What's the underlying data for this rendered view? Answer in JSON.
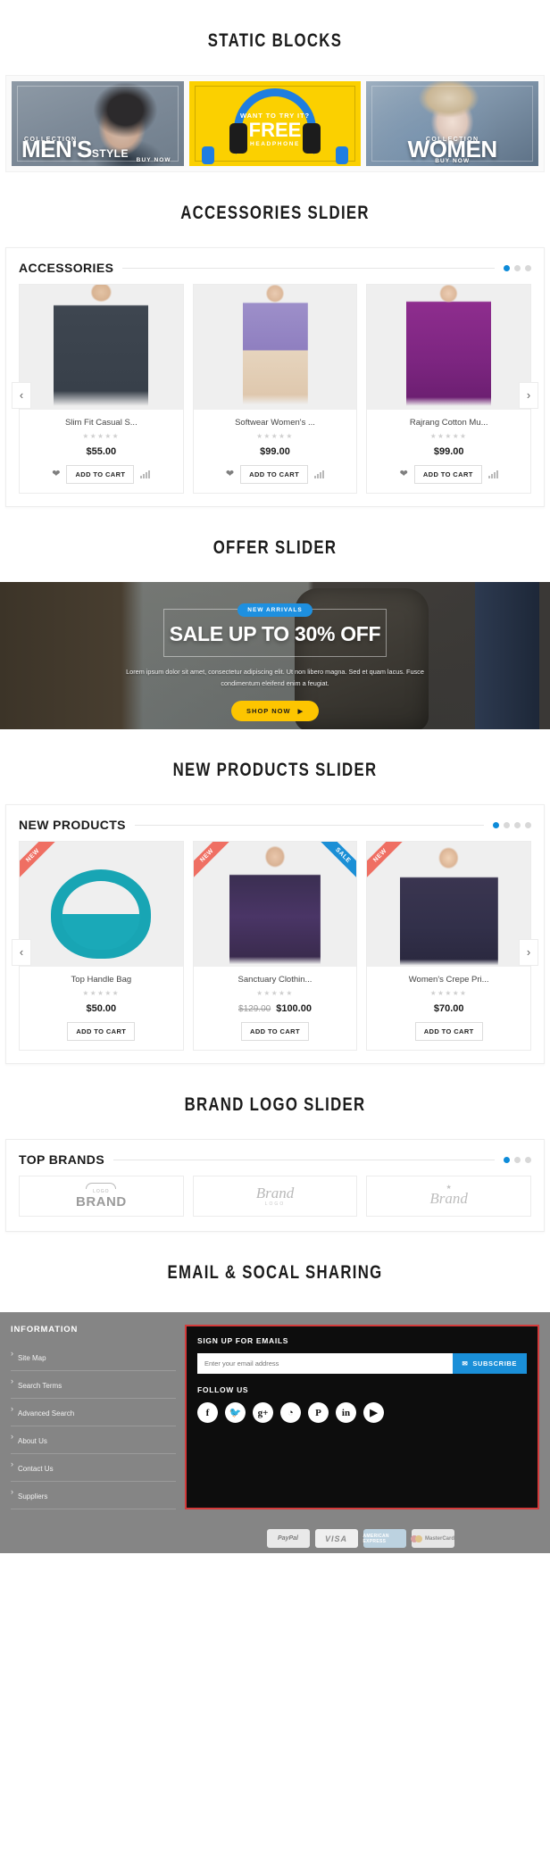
{
  "sections": {
    "static_blocks_title": "STATIC BLOCKS",
    "accessories_title": "ACCESSORIES SLDIER",
    "offer_title": "OFFER SLIDER",
    "new_products_title": "NEW PRODUCTS SLIDER",
    "brand_title": "BRAND LOGO SLIDER",
    "email_title": "EMAIL & SOCAL SHARING"
  },
  "static_blocks": [
    {
      "name": "mens-collection-block",
      "collection_label": "COLLECTION",
      "headline": "MEN'S",
      "headline_sub": "STYLE",
      "cta": "BUY NOW"
    },
    {
      "name": "free-headphone-block",
      "line1": "WANT TO TRY IT?",
      "line2": "FREE",
      "line3": "HEADPHONE"
    },
    {
      "name": "women-collection-block",
      "collection_label": "COLLECTION",
      "headline": "WOMEN",
      "cta": "BUY NOW"
    }
  ],
  "accessories_panel": {
    "heading": "ACCESSORIES",
    "dots": [
      true,
      false,
      false
    ],
    "prev_label": "‹",
    "next_label": "›",
    "add_to_cart_label": "ADD TO CART",
    "products": [
      {
        "name": "Slim Fit Casual S...",
        "rating": "★★★★★",
        "price": "$55.00",
        "old_price": "",
        "image": "ph-shirt"
      },
      {
        "name": "Softwear Women's ...",
        "rating": "★★★★★",
        "price": "$99.00",
        "old_price": "",
        "image": "ph-lace"
      },
      {
        "name": "Rajrang Cotton Mu...",
        "rating": "★★★★★",
        "price": "$99.00",
        "old_price": "",
        "image": "ph-purple"
      }
    ]
  },
  "offer_slider": {
    "badge": "NEW ARRIVALS",
    "headline": "SALE UP TO 30% OFF",
    "description": "Lorem ipsum dolor sit amet, consectetur adipiscing elit. Ut non libero magna. Sed et quam lacus. Fusce condimentum eleifend enim a feugiat.",
    "button": "SHOP NOW",
    "button_arrow": "▶",
    "dots": [
      true,
      false,
      false
    ]
  },
  "new_products_panel": {
    "heading": "NEW PRODUCTS",
    "dots": [
      true,
      false,
      false,
      false
    ],
    "prev_label": "‹",
    "next_label": "›",
    "add_to_cart_label": "ADD TO CART",
    "products": [
      {
        "name": "Top Handle Bag",
        "rating": "★★★★★",
        "price": "$50.00",
        "old_price": "",
        "badge_new": "NEW",
        "badge_sale": "",
        "image": "ph-bag"
      },
      {
        "name": "Sanctuary Clothin...",
        "rating": "★★★★★",
        "price": "$100.00",
        "old_price": "$129.00",
        "badge_new": "NEW",
        "badge_sale": "SALE",
        "image": "ph-jacket"
      },
      {
        "name": "Women's Crepe Pri...",
        "rating": "★★★★★",
        "price": "$70.00",
        "old_price": "",
        "badge_new": "NEW",
        "badge_sale": "",
        "image": "ph-crepe"
      }
    ]
  },
  "brands_panel": {
    "heading": "TOP BRANDS",
    "dots": [
      true,
      false,
      false
    ],
    "logos": [
      {
        "small": "LOGO",
        "main": "BRAND"
      },
      {
        "main": "Brand",
        "small": "LOGO"
      },
      {
        "main": "Brand",
        "small": "★"
      }
    ]
  },
  "footer": {
    "information_heading": "INFORMATION",
    "links": [
      "Site Map",
      "Search Terms",
      "Advanced Search",
      "About Us",
      "Contact Us",
      "Suppliers"
    ],
    "signup_heading": "SIGN UP FOR EMAILS",
    "email_placeholder": "Enter your email address",
    "subscribe_label": "SUBSCRIBE",
    "subscribe_icon": "✉",
    "follow_heading": "FOLLOW US",
    "socials": [
      {
        "name": "facebook",
        "glyph": "f"
      },
      {
        "name": "twitter",
        "glyph": "🐦"
      },
      {
        "name": "google-plus",
        "glyph": "g+"
      },
      {
        "name": "rss",
        "glyph": "◔"
      },
      {
        "name": "pinterest",
        "glyph": "P"
      },
      {
        "name": "linkedin",
        "glyph": "in"
      },
      {
        "name": "youtube",
        "glyph": "▶"
      }
    ],
    "payments": [
      {
        "name": "paypal",
        "label": "PayPal"
      },
      {
        "name": "visa",
        "label": "VISA"
      },
      {
        "name": "amex",
        "label": "AMERICAN EXPRESS"
      },
      {
        "name": "mastercard",
        "label": "MasterCard"
      }
    ]
  },
  "colors": {
    "accent_blue": "#0d8bd9",
    "yellow": "#fbd000",
    "ribbon_new": "#ef6f63",
    "ribbon_sale": "#1b8fd6",
    "footer_gray": "#858585",
    "signup_border": "#d33b3b"
  }
}
